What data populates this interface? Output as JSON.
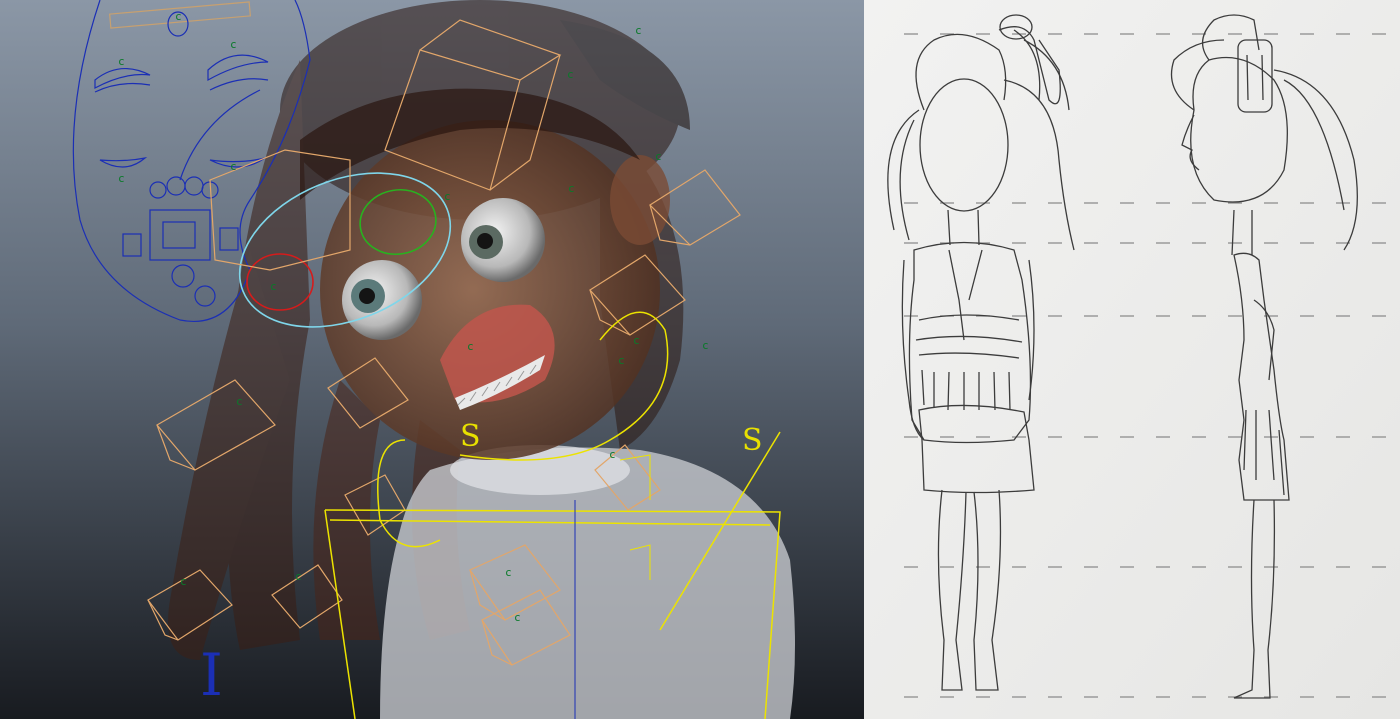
{
  "viewport": {
    "control_marker": "c",
    "shoulder_labels": [
      "S",
      "S"
    ],
    "root_label": "I",
    "colors": {
      "background_top": "#8a96a5",
      "background_bottom": "#1a1d22",
      "face_panel": "#1b2fb5",
      "cube_controls": "#e2a66a",
      "body_controls": "#ece300",
      "control_markers": "#0a7a2a",
      "eye_left_control": "#d61b1b",
      "eye_right_control": "#28b21f",
      "eye_socket_control": "#7fd6ea"
    }
  },
  "sketch": {
    "colors": {
      "paper": "#efefee",
      "pencil": "#3c3c3c"
    }
  }
}
